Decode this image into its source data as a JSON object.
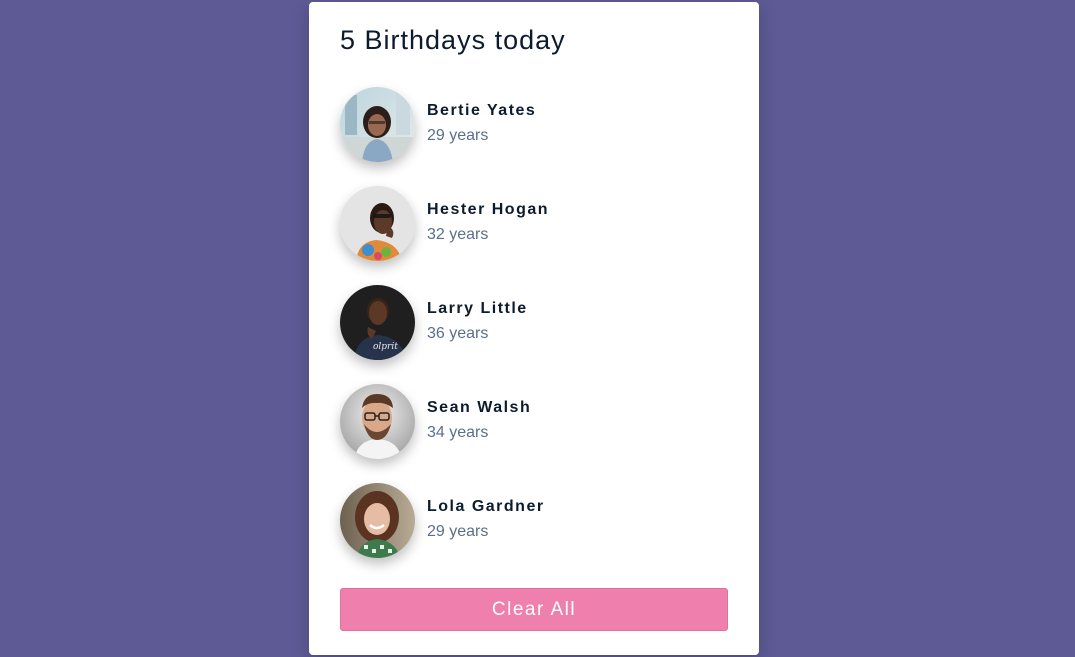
{
  "header": {
    "title": "5 Birthdays today"
  },
  "people": [
    {
      "name": "Bertie Yates",
      "age": "29 years",
      "avatar_icon": "person-photo-woman-city"
    },
    {
      "name": "Hester Hogan",
      "age": "32 years",
      "avatar_icon": "person-photo-woman-glasses"
    },
    {
      "name": "Larry Little",
      "age": "36 years",
      "avatar_icon": "person-photo-man-dark"
    },
    {
      "name": "Sean Walsh",
      "age": "34 years",
      "avatar_icon": "person-photo-man-glasses"
    },
    {
      "name": "Lola Gardner",
      "age": "29 years",
      "avatar_icon": "person-photo-woman-curly"
    }
  ],
  "actions": {
    "clear_label": "Clear All"
  },
  "colors": {
    "background": "#5d5a95",
    "card": "#ffffff",
    "button": "#ef7fac",
    "name_text": "#0d1b2e",
    "age_text": "#5a6f8a"
  }
}
